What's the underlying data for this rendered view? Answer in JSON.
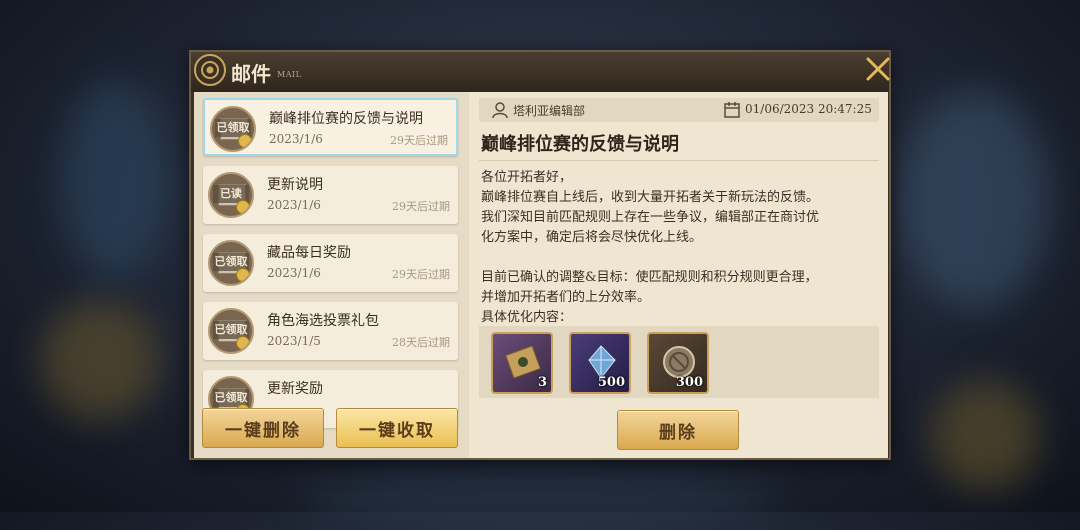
{
  "dialog": {
    "title": "邮件",
    "title_sub": "MAIL"
  },
  "mails": [
    {
      "title": "巅峰排位赛的反馈与说明",
      "date": "2023/1/6",
      "expire": "29天后过期",
      "status": "已领取",
      "selected": true
    },
    {
      "title": "更新说明",
      "date": "2023/1/6",
      "expire": "29天后过期",
      "status": "已读",
      "selected": false
    },
    {
      "title": "藏品每日奖励",
      "date": "2023/1/6",
      "expire": "29天后过期",
      "status": "已领取",
      "selected": false
    },
    {
      "title": "角色海选投票礼包",
      "date": "2023/1/5",
      "expire": "28天后过期",
      "status": "已领取",
      "selected": false
    },
    {
      "title": "更新奖励",
      "date": "",
      "expire": "",
      "status": "已领取",
      "selected": false
    }
  ],
  "buttons": {
    "delete_all": "一键删除",
    "claim_all": "一键收取",
    "delete": "删除"
  },
  "detail": {
    "sender": "塔利亚编辑部",
    "datetime": "01/06/2023 20:47:25",
    "heading": "巅峰排位赛的反馈与说明",
    "body": [
      "各位开拓者好，",
      "巅峰排位赛自上线后，收到大量开拓者关于新玩法的反馈。",
      "我们深知目前匹配规则上存在一些争议，编辑部正在商讨优",
      "化方案中，确定后将会尽快优化上线。",
      "",
      "目前已确认的调整&目标：使匹配规则和积分规则更合理，",
      "并增加开拓者们的上分效率。",
      "具体优化内容："
    ],
    "rewards": [
      {
        "icon": "ticket-item-icon",
        "qty": "3"
      },
      {
        "icon": "crystal-item-icon",
        "qty": "500"
      },
      {
        "icon": "coin-item-icon",
        "qty": "300"
      }
    ]
  },
  "colors": {
    "accent_gold": "#d9a94f",
    "selected_border": "#9fd8ea",
    "panel_bg": "#efe6d2"
  }
}
